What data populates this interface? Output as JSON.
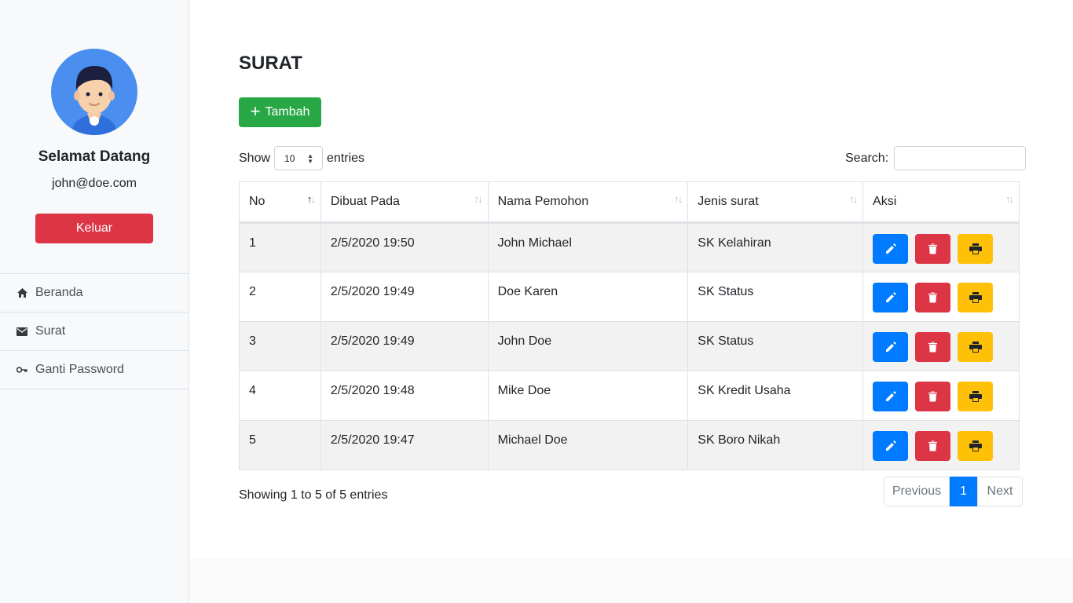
{
  "sidebar": {
    "welcome": "Selamat Datang",
    "email": "john@doe.com",
    "logout_label": "Keluar",
    "items": [
      {
        "label": "Beranda",
        "icon": "home-icon"
      },
      {
        "label": "Surat",
        "icon": "mail-icon"
      },
      {
        "label": "Ganti Password",
        "icon": "key-icon"
      }
    ]
  },
  "main": {
    "title": "SURAT",
    "add_label": "Tambah",
    "show_label": "Show",
    "entries_label": "entries",
    "page_length": "10",
    "search_label": "Search:",
    "search_value": "",
    "columns": [
      "No",
      "Dibuat Pada",
      "Nama Pemohon",
      "Jenis surat",
      "Aksi"
    ],
    "rows": [
      {
        "no": "1",
        "created": "2/5/2020 19:50",
        "name": "John Michael",
        "type": "SK Kelahiran"
      },
      {
        "no": "2",
        "created": "2/5/2020 19:49",
        "name": "Doe Karen",
        "type": "SK Status"
      },
      {
        "no": "3",
        "created": "2/5/2020 19:49",
        "name": "John Doe",
        "type": "SK Status"
      },
      {
        "no": "4",
        "created": "2/5/2020 19:48",
        "name": "Mike Doe",
        "type": "SK Kredit Usaha"
      },
      {
        "no": "5",
        "created": "2/5/2020 19:47",
        "name": "Michael Doe",
        "type": "SK Boro Nikah"
      }
    ],
    "info": "Showing 1 to 5 of 5 entries",
    "pager": {
      "prev": "Previous",
      "current": "1",
      "next": "Next"
    }
  },
  "colors": {
    "primary": "#007bff",
    "success": "#28a745",
    "danger": "#dc3545",
    "warning": "#ffc107",
    "avatar_bg": "#4a8ff0"
  }
}
